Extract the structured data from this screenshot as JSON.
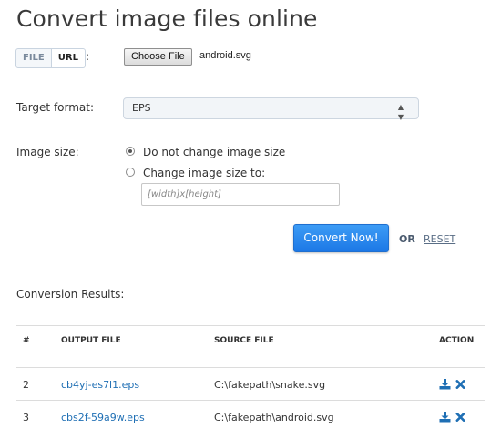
{
  "page": {
    "title": "Convert image files online"
  },
  "source": {
    "tabs": [
      "FILE",
      "URL"
    ],
    "colon": ":",
    "choose_file_label": "Choose File",
    "file_name": "android.svg"
  },
  "target_format": {
    "label": "Target format:",
    "selected": "EPS"
  },
  "image_size": {
    "label": "Image size:",
    "options": [
      "Do not change image size",
      "Change image size to:"
    ],
    "selected_index": 0,
    "input_placeholder": "[width]x[height]"
  },
  "actions": {
    "convert_label": "Convert Now!",
    "or_label": "OR",
    "reset_label": "RESET"
  },
  "results": {
    "title": "Conversion Results:",
    "headers": [
      "#",
      "OUTPUT FILE",
      "SOURCE FILE",
      "ACTION"
    ],
    "rows": [
      {
        "num": "2",
        "output": "cb4yj-es7l1.eps",
        "source": "C:\\fakepath\\snake.svg"
      },
      {
        "num": "3",
        "output": "cbs2f-59a9w.eps",
        "source": "C:\\fakepath\\android.svg"
      }
    ]
  },
  "colors": {
    "accent": "#1c78e6",
    "link": "#1f6fb4"
  }
}
